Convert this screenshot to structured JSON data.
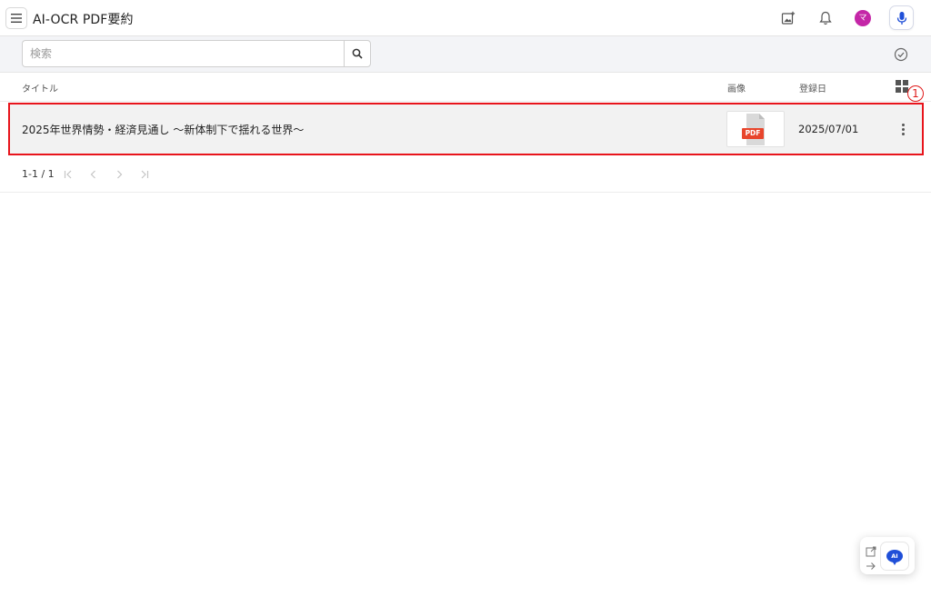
{
  "app": {
    "title": "AI-OCR PDF要約",
    "avatar_initial": "マ",
    "avatar_color": "#c426a7",
    "accent_color": "#1f4fd8"
  },
  "icons": {
    "menu": "hamburger-menu-icon",
    "add_image": "add-image-icon",
    "bell": "notification-bell-icon",
    "mic": "microphone-icon",
    "search": "search-icon",
    "check": "check-circle-icon",
    "grid": "grid-view-icon",
    "more": "more-vertical-icon",
    "open_external": "open-external-icon",
    "arrow": "arrow-right-icon",
    "ai": "ai-chat-icon"
  },
  "search": {
    "placeholder": "検索",
    "value": ""
  },
  "table": {
    "columns": {
      "title": "タイトル",
      "image": "画像",
      "date": "登録日"
    },
    "rows": [
      {
        "title": "2025年世界情勢・経済見通し 〜新体制下で揺れる世界〜",
        "thumbnail_label": "PDF",
        "date": "2025/07/01"
      }
    ]
  },
  "annotation": {
    "marker": "1",
    "color": "#e8141c"
  },
  "pagination": {
    "range": "1-1 / 1"
  },
  "ai_panel": {
    "label": "AI"
  }
}
